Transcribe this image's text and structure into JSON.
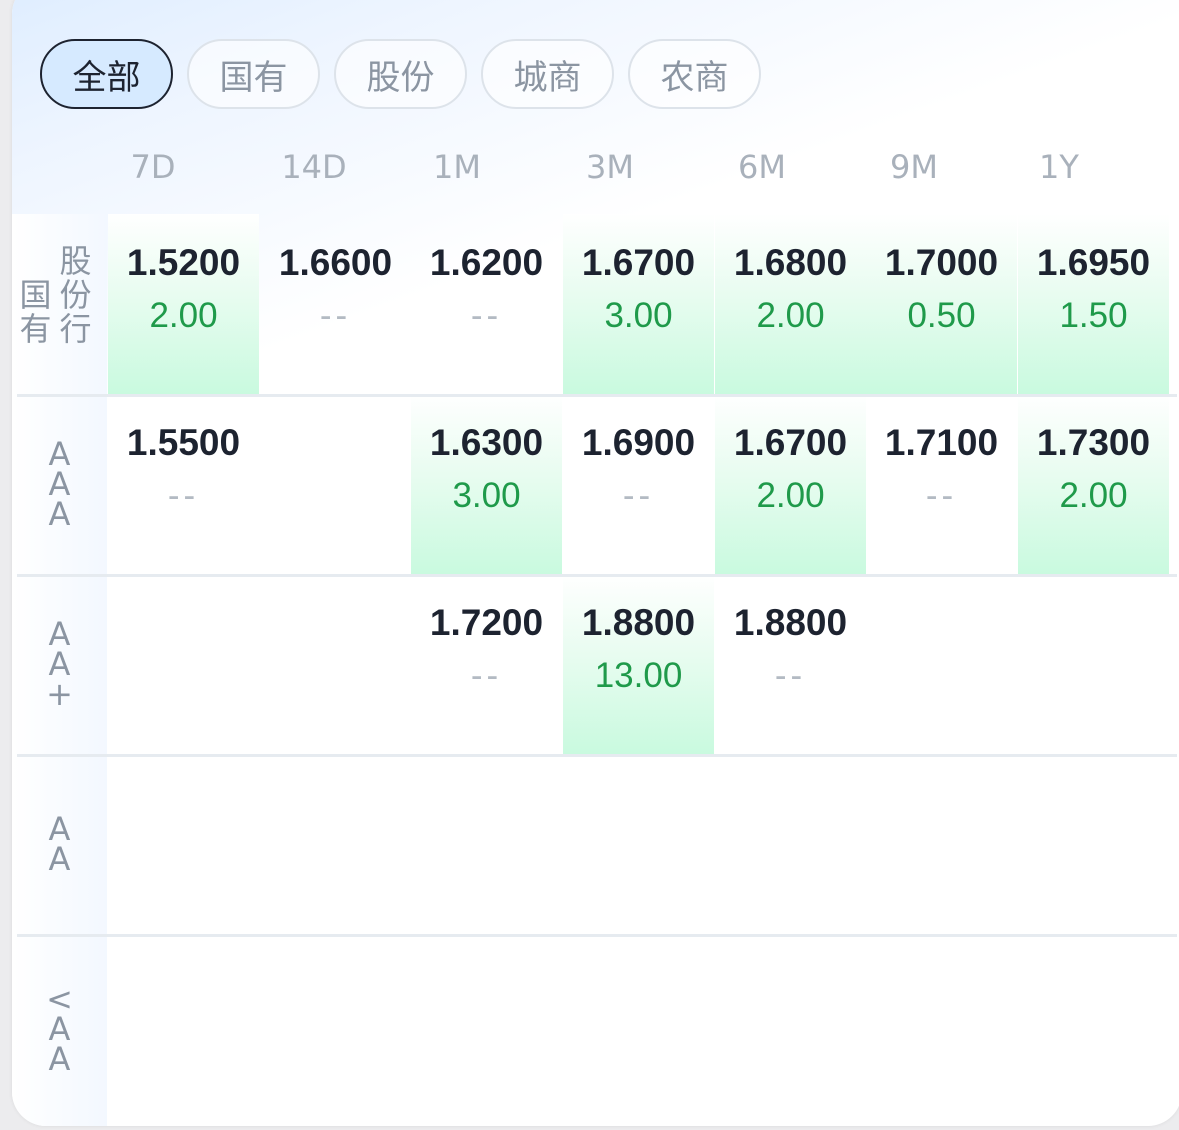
{
  "filters": [
    {
      "label": "全部",
      "active": true
    },
    {
      "label": "国有",
      "active": false
    },
    {
      "label": "股份",
      "active": false
    },
    {
      "label": "城商",
      "active": false
    },
    {
      "label": "农商",
      "active": false
    }
  ],
  "tenors": [
    "7D",
    "14D",
    "1M",
    "3M",
    "6M",
    "9M",
    "1Y"
  ],
  "rows": [
    {
      "label_left": [
        "国",
        "有"
      ],
      "label_right": [
        "股",
        "份",
        "行"
      ],
      "cells": [
        {
          "rate": "1.5200",
          "vol": "2.00",
          "highlight": true
        },
        {
          "rate": "1.6600",
          "vol": "--",
          "highlight": false
        },
        {
          "rate": "1.6200",
          "vol": "--",
          "highlight": false
        },
        {
          "rate": "1.6700",
          "vol": "3.00",
          "highlight": true
        },
        {
          "rate": "1.6800",
          "vol": "2.00",
          "highlight": true
        },
        {
          "rate": "1.7000",
          "vol": "0.50",
          "highlight": true
        },
        {
          "rate": "1.6950",
          "vol": "1.50",
          "highlight": true
        }
      ]
    },
    {
      "label": [
        "A",
        "A",
        "A"
      ],
      "cells": [
        {
          "rate": "1.5500",
          "vol": "--",
          "highlight": false
        },
        null,
        {
          "rate": "1.6300",
          "vol": "3.00",
          "highlight": true
        },
        {
          "rate": "1.6900",
          "vol": "--",
          "highlight": false
        },
        {
          "rate": "1.6700",
          "vol": "2.00",
          "highlight": true
        },
        {
          "rate": "1.7100",
          "vol": "--",
          "highlight": false
        },
        {
          "rate": "1.7300",
          "vol": "2.00",
          "highlight": true
        }
      ]
    },
    {
      "label": [
        "A",
        "A",
        "+"
      ],
      "cells": [
        null,
        null,
        {
          "rate": "1.7200",
          "vol": "--",
          "highlight": false
        },
        {
          "rate": "1.8800",
          "vol": "13.00",
          "highlight": true
        },
        {
          "rate": "1.8800",
          "vol": "--",
          "highlight": false
        },
        null,
        null
      ]
    },
    {
      "label": [
        "A",
        "A"
      ],
      "cells": [
        null,
        null,
        null,
        null,
        null,
        null,
        null
      ]
    },
    {
      "label": [
        "<",
        "A",
        "A"
      ],
      "cells": [
        null,
        null,
        null,
        null,
        null,
        null,
        null
      ]
    }
  ],
  "colors": {
    "accent_pill_bg": "#d6eaff",
    "rate_text": "#1d2330",
    "volume_green": "#1f9a4a",
    "highlight_green": "#c9fadf"
  }
}
